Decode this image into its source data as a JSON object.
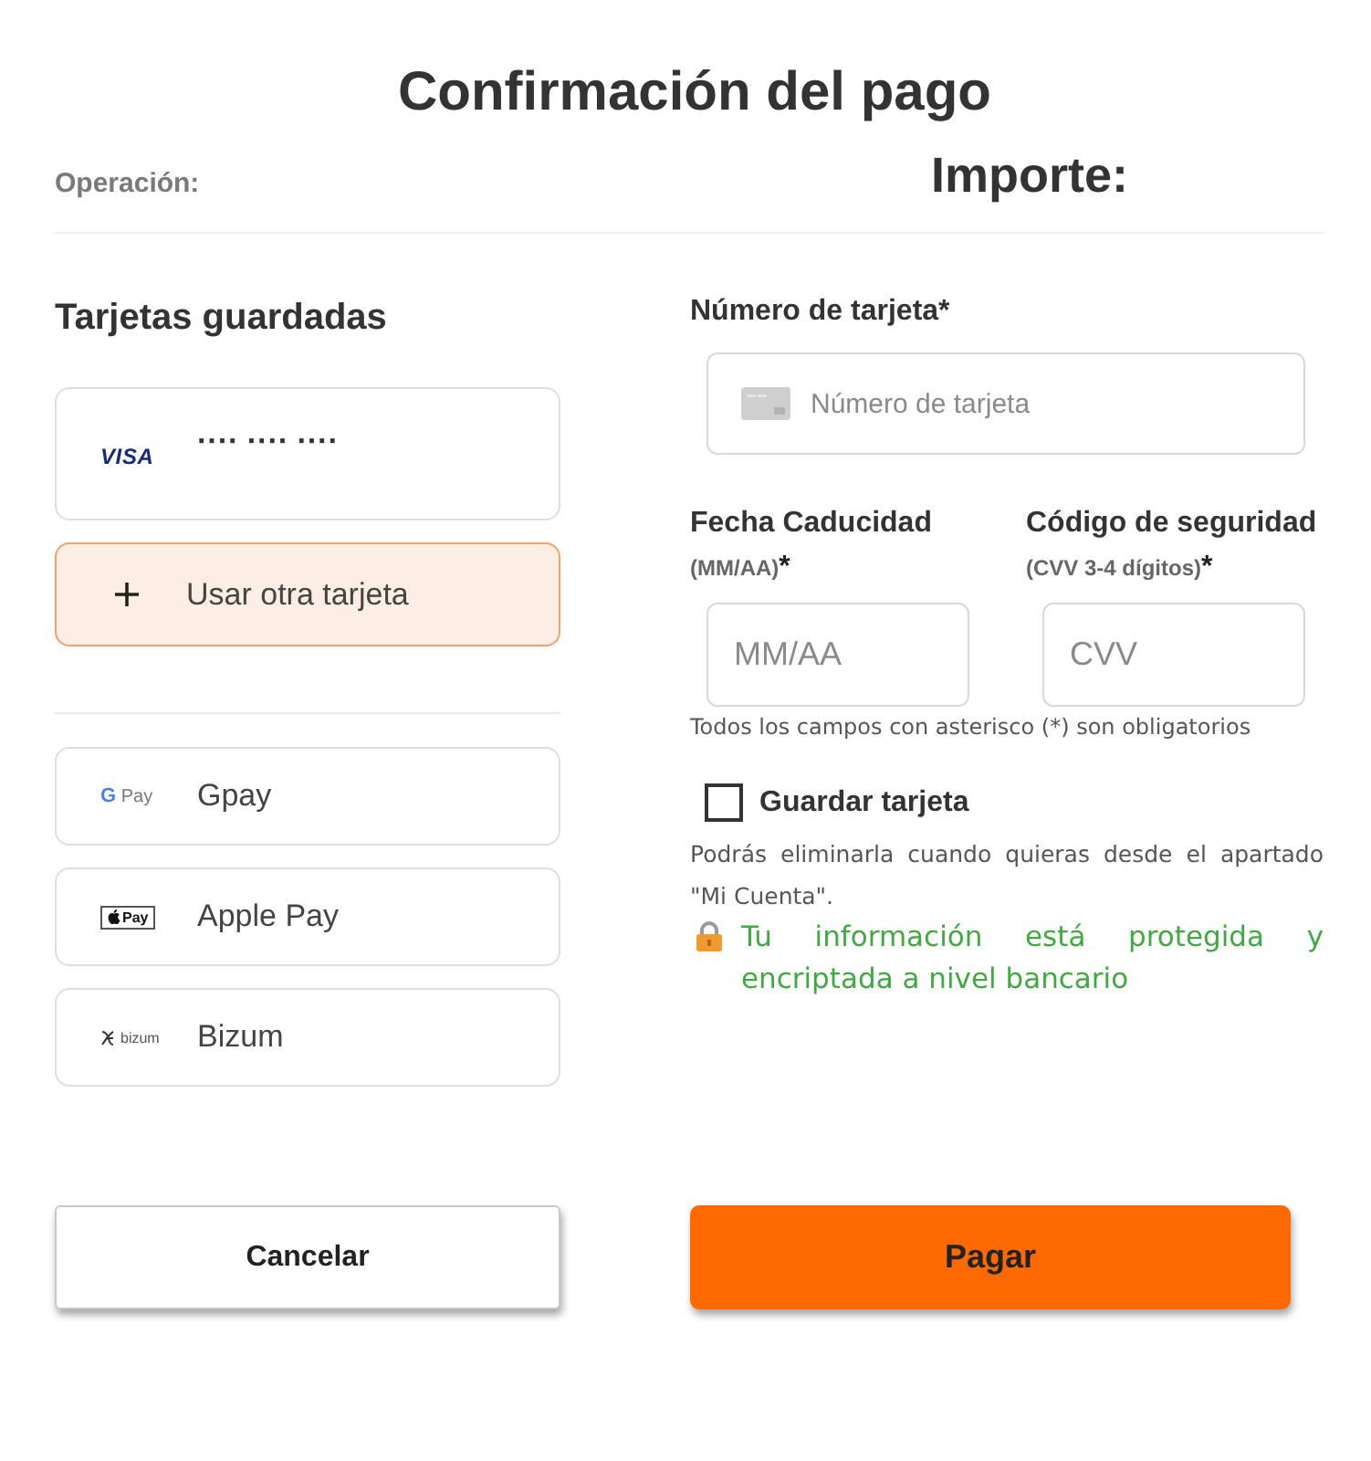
{
  "title": "Confirmación del pago",
  "summary": {
    "operation_label": "Operación:",
    "amount_label": "Importe:"
  },
  "saved_cards": {
    "heading": "Tarjetas guardadas",
    "options": [
      {
        "kind": "saved",
        "brand": "VISA",
        "number": "···· ···· ····",
        "selected": false
      },
      {
        "kind": "new",
        "label": "Usar otra tarjeta",
        "selected": true
      }
    ]
  },
  "wallets": [
    {
      "kind": "gpay",
      "logo_mark": "G",
      "logo_text": "Pay",
      "label": "Gpay",
      "selected": false
    },
    {
      "kind": "applepay",
      "logo_text": "Pay",
      "label": "Apple Pay",
      "selected": false
    },
    {
      "kind": "bizum",
      "logo_text": "bizum",
      "label": "Bizum",
      "selected": false
    }
  ],
  "card_form": {
    "number": {
      "label": "Número de tarjeta*",
      "placeholder": "Número de tarjeta"
    },
    "expiry": {
      "label": "Fecha Caducidad",
      "hint": "(MM/AA)",
      "required_mark": "*",
      "placeholder": "MM/AA"
    },
    "cvv": {
      "label": "Código de seguridad",
      "hint": "(CVV 3-4 dígitos)",
      "required_mark": "*",
      "placeholder": "CVV"
    },
    "required_note": "Todos los campos con asterisco (*) son obligatorios"
  },
  "save_card": {
    "label": "Guardar tarjeta",
    "checked": false,
    "note": "Podrás eliminarla cuando quieras desde el apartado \"Mi Cuenta\"."
  },
  "security_note": "Tu información está protegida y encriptada a nivel bancario",
  "buttons": [
    {
      "kind": "secondary",
      "label": "Cancelar"
    },
    {
      "kind": "primary",
      "label": "Pagar"
    }
  ]
}
